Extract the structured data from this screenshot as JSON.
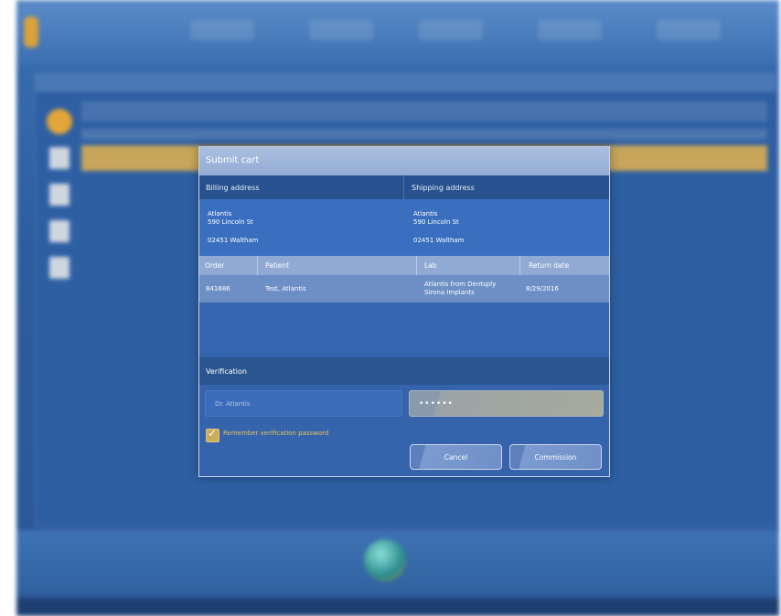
{
  "dialog": {
    "title": "Submit cart",
    "billing": {
      "header": "Billing address",
      "name": "Atlantis",
      "street": "590 Lincoln St",
      "city_line": "02451 Waltham"
    },
    "shipping": {
      "header": "Shipping address",
      "name": "Atlantis",
      "street": "590 Lincoln St",
      "city_line": "02451 Waltham"
    },
    "table": {
      "columns": [
        "Order",
        "Patient",
        "Lab",
        "Return date"
      ],
      "rows": [
        {
          "order": "841686",
          "patient": "Test, Atlantis",
          "lab_line1": "Atlantis from Dentsply",
          "lab_line2": "Sirona Implants",
          "return_date": "8/29/2016"
        }
      ]
    },
    "verification": {
      "header": "Verification",
      "username_placeholder": "Dr. Atlantis",
      "password_value": "••••••",
      "remember_label": "Remember verification password",
      "remember_checked": true
    },
    "buttons": {
      "cancel": "Cancel",
      "commission": "Commission"
    }
  },
  "colors": {
    "dialog_bg": "#2f61aa",
    "title_bar": "#93acd4",
    "accent_gold": "#e8c25a"
  }
}
